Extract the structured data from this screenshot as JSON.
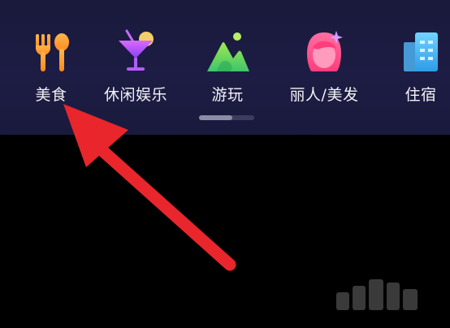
{
  "categories": [
    {
      "label": "美食",
      "icon": "fork-spoon-icon"
    },
    {
      "label": "休闲娱乐",
      "icon": "cocktail-icon"
    },
    {
      "label": "游玩",
      "icon": "mountain-icon"
    },
    {
      "label": "丽人/美发",
      "icon": "woman-face-icon"
    },
    {
      "label": "住宿",
      "icon": "hotel-building-icon"
    }
  ],
  "pager": {
    "current_fraction": 0.6
  },
  "annotation": {
    "color": "#e8262b",
    "points_to": "美食"
  }
}
